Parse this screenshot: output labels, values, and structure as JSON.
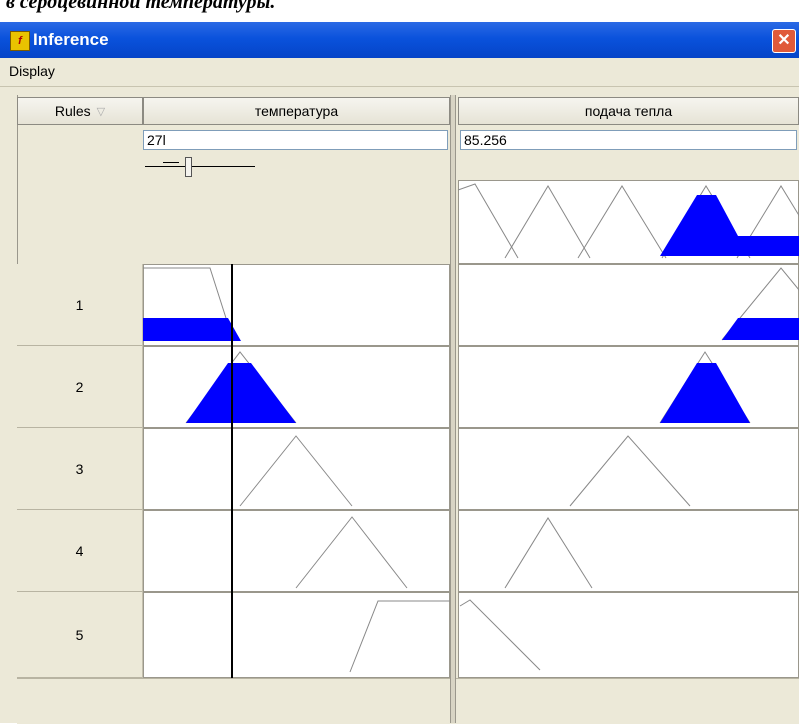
{
  "doc_caption": "в сердцевинной температуры.",
  "window": {
    "title": "Inference",
    "icon": "fis-app-icon",
    "close_label": "✕"
  },
  "menu": {
    "items": [
      "Display"
    ]
  },
  "table": {
    "rules_header": "Rules",
    "input_header": "температура",
    "output_header": "подача тепла",
    "input_value": "27l",
    "output_value": "85.256",
    "rule_numbers": [
      "1",
      "2",
      "3",
      "4",
      "5"
    ]
  },
  "colors": {
    "fill": "#0000ff",
    "titlebar": "#0a52dc",
    "panel": "#ece9d8"
  }
}
